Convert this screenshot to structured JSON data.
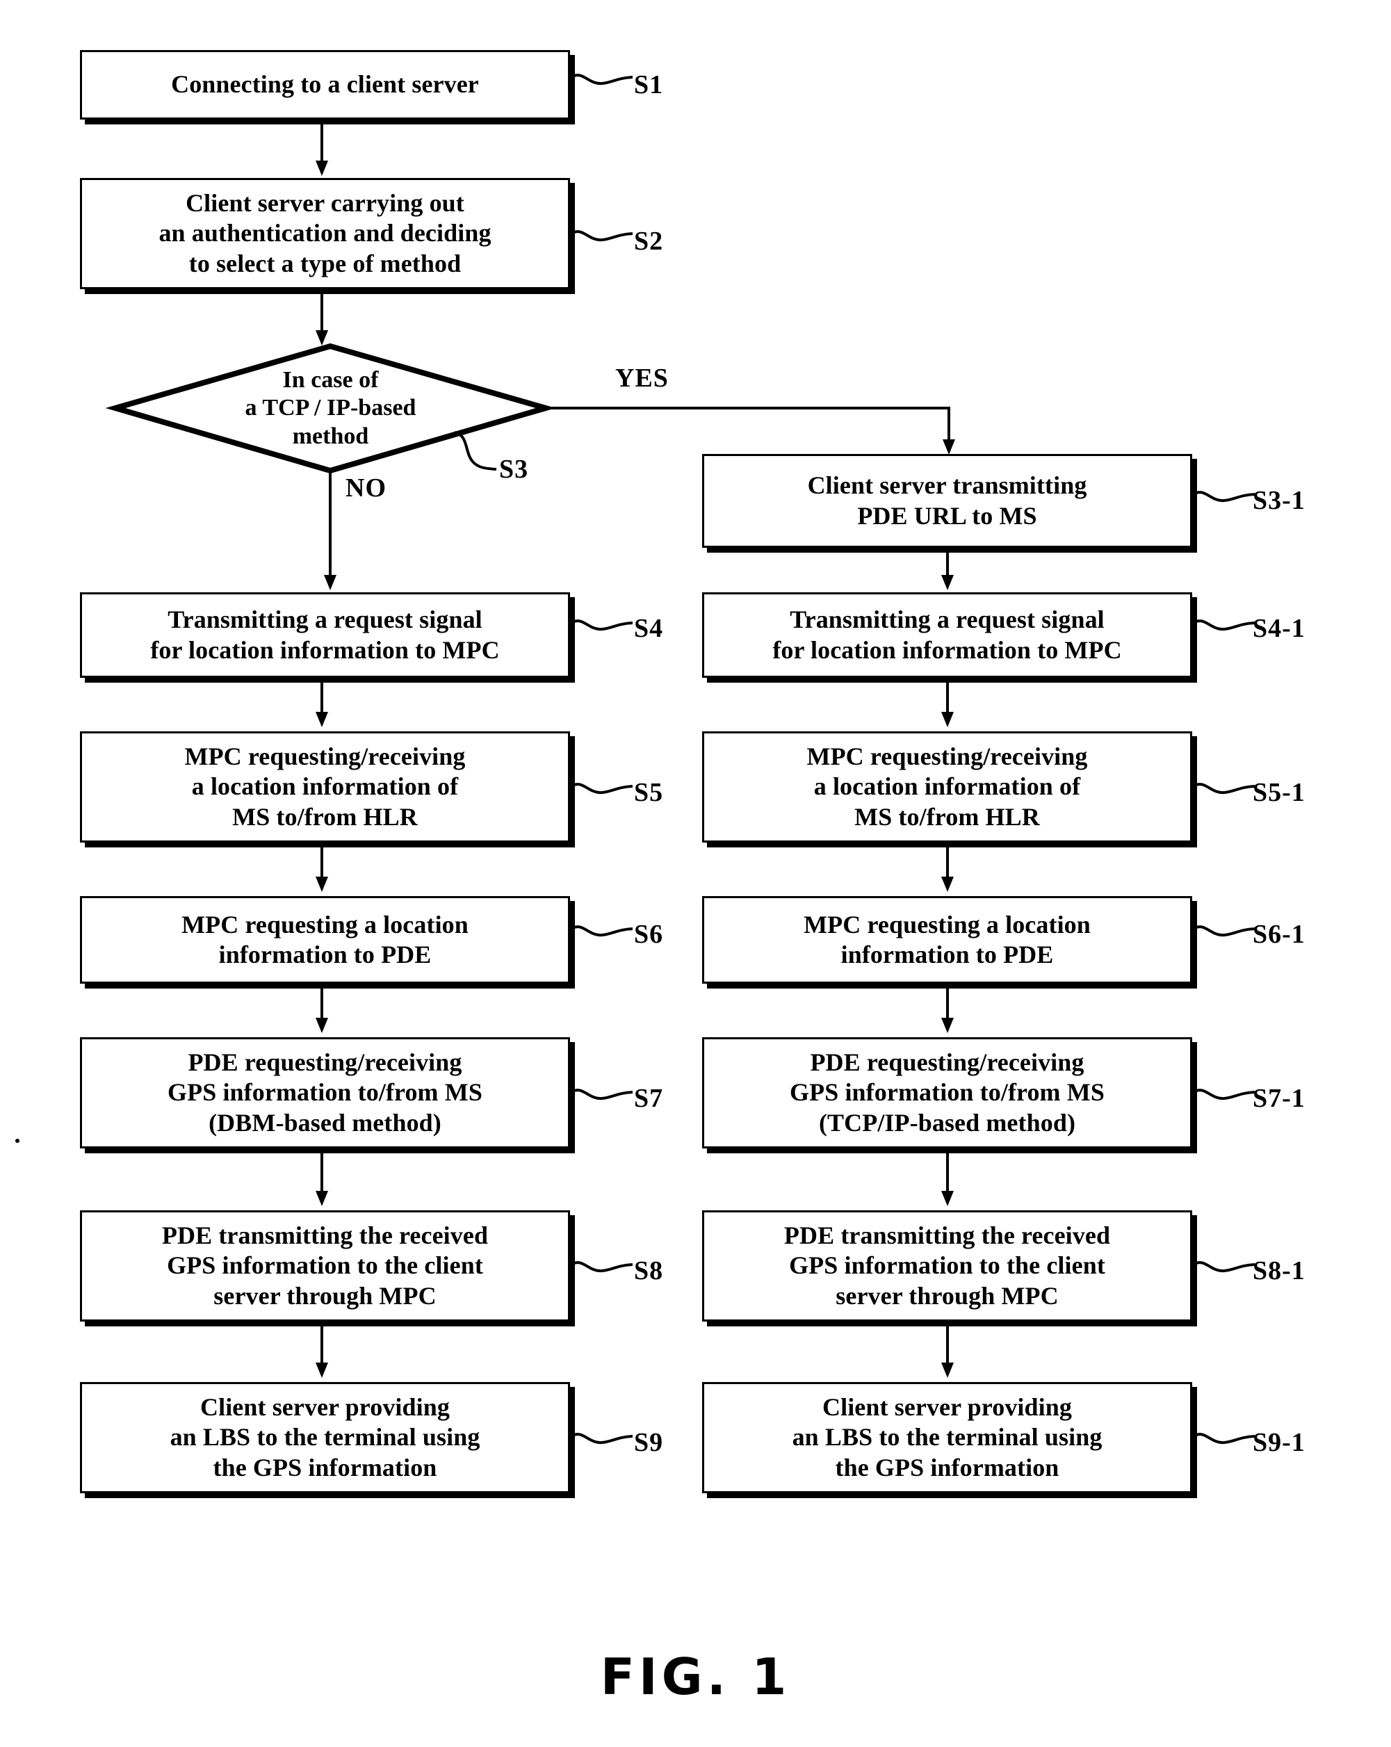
{
  "figure": {
    "caption": "FIG.  1",
    "type": "flowchart",
    "title_implicit": "Location Based Service (LBS) provisioning flow"
  },
  "branches": {
    "yes_label": "YES",
    "no_label": "NO"
  },
  "decision": {
    "id": "S3",
    "text": "In case of\na TCP / IP-based\nmethod",
    "step_label": "S3"
  },
  "common": [
    {
      "id": "S1",
      "text": "Connecting to a client server",
      "step_label": "S1"
    },
    {
      "id": "S2",
      "text": "Client server carrying out\nan authentication and deciding\nto select a type of method",
      "step_label": "S2"
    }
  ],
  "left_column": [
    {
      "id": "S4",
      "text": "Transmitting a request signal\nfor location information to MPC",
      "step_label": "S4"
    },
    {
      "id": "S5",
      "text": "MPC requesting/receiving\na location information of\nMS to/from HLR",
      "step_label": "S5"
    },
    {
      "id": "S6",
      "text": "MPC requesting a location\ninformation to PDE",
      "step_label": "S6"
    },
    {
      "id": "S7",
      "text": "PDE requesting/receiving\nGPS information to/from MS\n(DBM-based method)",
      "step_label": "S7"
    },
    {
      "id": "S8",
      "text": "PDE transmitting the received\nGPS information to the client\nserver through MPC",
      "step_label": "S8"
    },
    {
      "id": "S9",
      "text": "Client server providing\nan LBS to the terminal using\nthe GPS information",
      "step_label": "S9"
    }
  ],
  "right_column": [
    {
      "id": "S3-1",
      "text": "Client server transmitting\nPDE URL to MS",
      "step_label": "S3-1"
    },
    {
      "id": "S4-1",
      "text": "Transmitting a request signal\nfor location information to MPC",
      "step_label": "S4-1"
    },
    {
      "id": "S5-1",
      "text": "MPC requesting/receiving\na location information of\nMS to/from HLR",
      "step_label": "S5-1"
    },
    {
      "id": "S6-1",
      "text": "MPC requesting a location\ninformation to PDE",
      "step_label": "S6-1"
    },
    {
      "id": "S7-1",
      "text": "PDE requesting/receiving\nGPS information to/from MS\n(TCP/IP-based method)",
      "step_label": "S7-1"
    },
    {
      "id": "S8-1",
      "text": "PDE transmitting the received\nGPS information to the client\nserver through MPC",
      "step_label": "S8-1"
    },
    {
      "id": "S9-1",
      "text": "Client server providing\nan LBS to the terminal using\nthe GPS information",
      "step_label": "S9-1"
    }
  ],
  "colors": {
    "ink": "#000000",
    "paper": "#ffffff"
  }
}
